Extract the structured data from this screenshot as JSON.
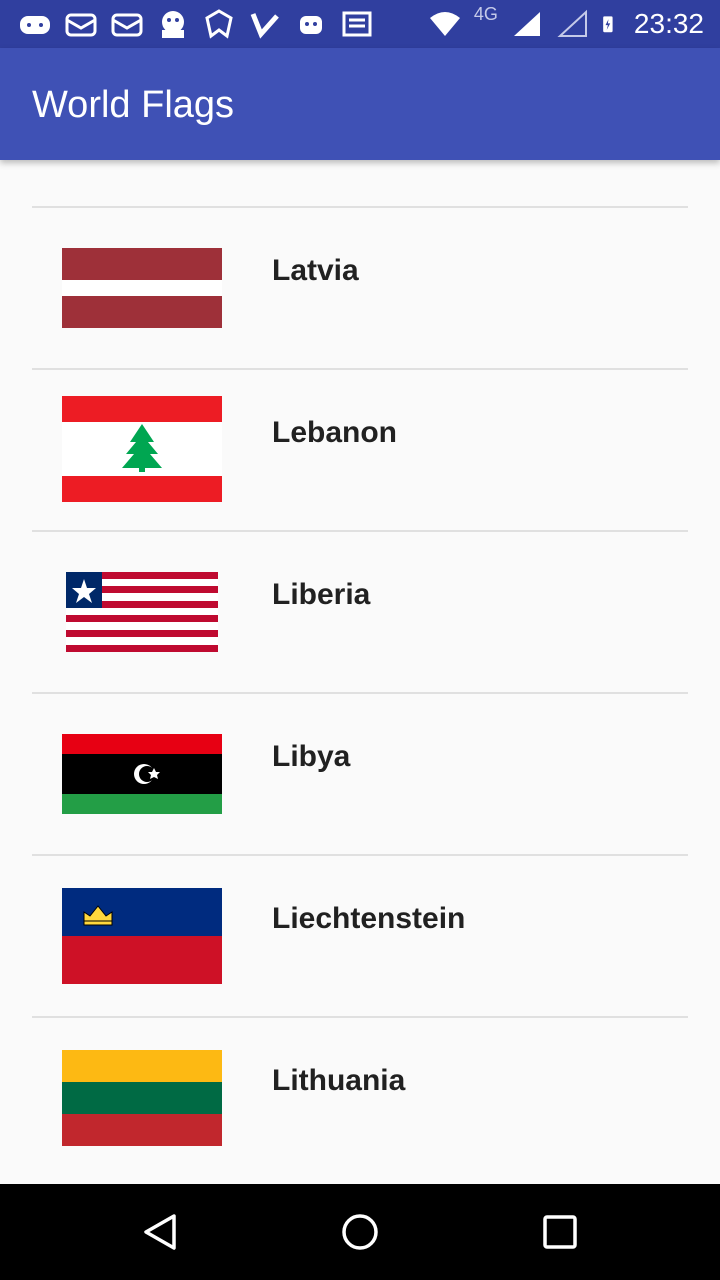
{
  "status_bar": {
    "time": "23:32",
    "network": "4G",
    "icons": [
      "gamepad-icon",
      "mail-icon",
      "mail-icon",
      "mascot-icon",
      "signal-brand-icon",
      "check-icon",
      "android-icon",
      "news-icon",
      "wifi-icon",
      "cell-signal-icon",
      "cell-signal-empty-icon",
      "battery-charging-icon"
    ]
  },
  "app_bar": {
    "title": "World Flags"
  },
  "countries": [
    {
      "name": "Latvia",
      "flag": "latvia-flag"
    },
    {
      "name": "Lebanon",
      "flag": "lebanon-flag"
    },
    {
      "name": "Liberia",
      "flag": "liberia-flag"
    },
    {
      "name": "Libya",
      "flag": "libya-flag"
    },
    {
      "name": "Liechtenstein",
      "flag": "liechtenstein-flag"
    },
    {
      "name": "Lithuania",
      "flag": "lithuania-flag"
    }
  ],
  "nav_bar": {
    "buttons": [
      "back-icon",
      "home-icon",
      "recents-icon"
    ]
  },
  "colors": {
    "status_bar": "#303f9f",
    "app_bar": "#3f51b5",
    "background": "#fafafa",
    "divider": "#e0e0e0",
    "text": "#212121"
  }
}
